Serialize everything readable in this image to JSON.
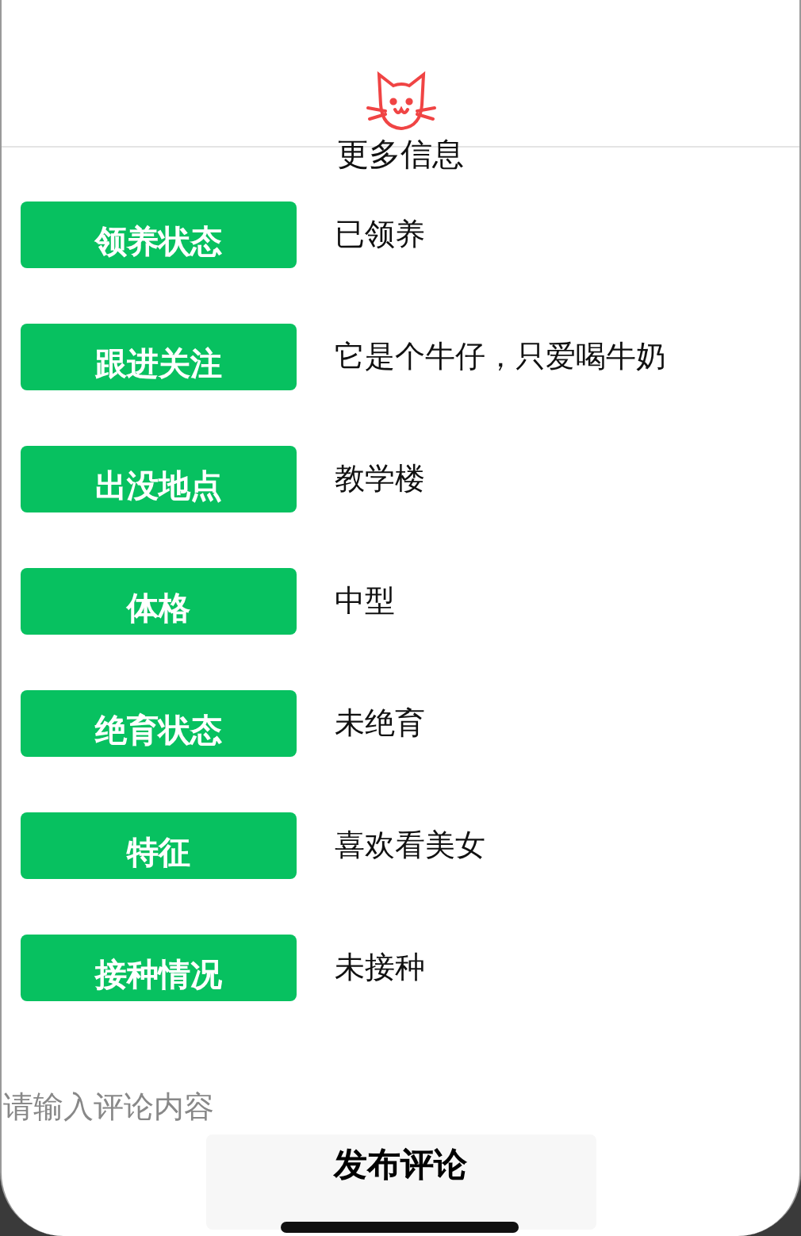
{
  "header": {
    "title": "更多信息"
  },
  "rows": [
    {
      "label": "领养状态",
      "value": "已领养"
    },
    {
      "label": "跟进关注",
      "value": "它是个牛仔，只爱喝牛奶"
    },
    {
      "label": "出没地点",
      "value": "教学楼"
    },
    {
      "label": "体格",
      "value": "中型"
    },
    {
      "label": "绝育状态",
      "value": "未绝育"
    },
    {
      "label": "特征",
      "value": "喜欢看美女"
    },
    {
      "label": "接种情况",
      "value": "未接种"
    }
  ],
  "comment": {
    "placeholder": "请输入评论内容",
    "button": "发布评论"
  }
}
